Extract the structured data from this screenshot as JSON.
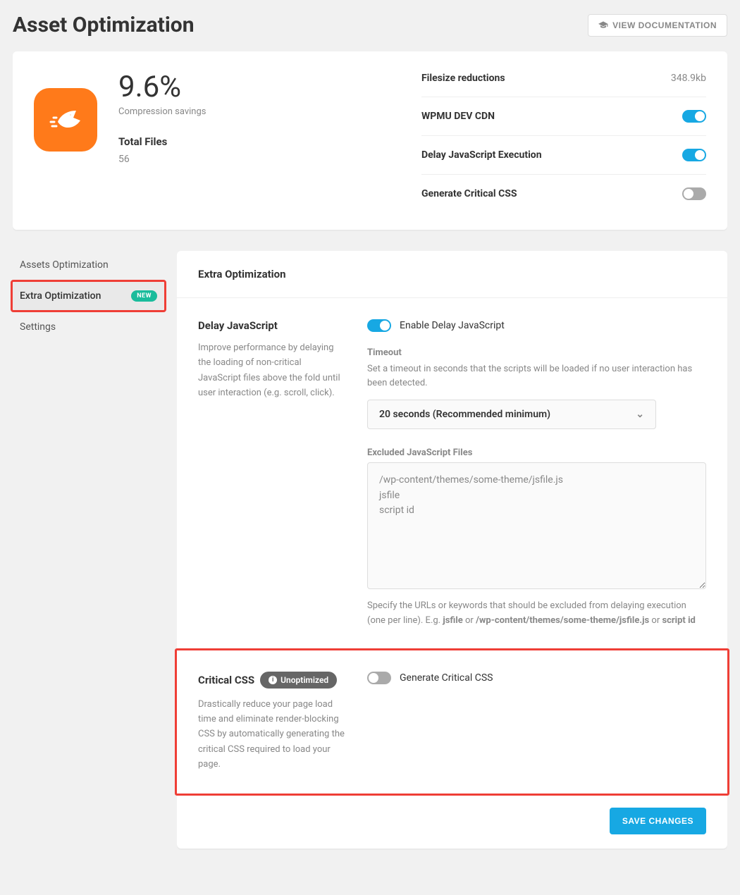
{
  "header": {
    "title": "Asset Optimization",
    "docButton": "VIEW DOCUMENTATION"
  },
  "summary": {
    "percent": "9.6%",
    "percentLabel": "Compression savings",
    "totalFilesLabel": "Total Files",
    "totalFilesValue": "56",
    "rows": {
      "filesize": {
        "label": "Filesize reductions",
        "value": "348.9kb"
      },
      "cdn": {
        "label": "WPMU DEV CDN"
      },
      "delayjs": {
        "label": "Delay JavaScript Execution"
      },
      "critical": {
        "label": "Generate Critical CSS"
      }
    }
  },
  "sidebar": {
    "item1": "Assets Optimization",
    "item2": "Extra Optimization",
    "item2badge": "NEW",
    "item3": "Settings"
  },
  "panel": {
    "title": "Extra Optimization",
    "delay": {
      "title": "Delay JavaScript",
      "desc": "Improve performance by delaying the loading of non-critical JavaScript files above the fold until user interaction (e.g. scroll, click).",
      "toggleLabel": "Enable Delay JavaScript",
      "timeoutLabel": "Timeout",
      "timeoutHelp": "Set a timeout in seconds that the scripts will be loaded if no user interaction has been detected.",
      "timeoutValue": "20 seconds (Recommended minimum)",
      "excludedLabel": "Excluded JavaScript Files",
      "excludedValue": "/wp-content/themes/some-theme/jsfile.js\njsfile\nscript id",
      "excludedHelpPrefix": "Specify the URLs or keywords that should be excluded from delaying execution (one per line). E.g. ",
      "eg1": "jsfile",
      "egOr1": " or ",
      "eg2": "/wp-content/themes/some-theme/jsfile.js",
      "egOr2": " or ",
      "eg3": "script id"
    },
    "critical": {
      "title": "Critical CSS",
      "pill": "Unoptimized",
      "desc": "Drastically reduce your page load time and eliminate render-blocking CSS by automatically generating the critical CSS required to load your page.",
      "toggleLabel": "Generate Critical CSS"
    },
    "saveBtn": "SAVE CHANGES"
  }
}
